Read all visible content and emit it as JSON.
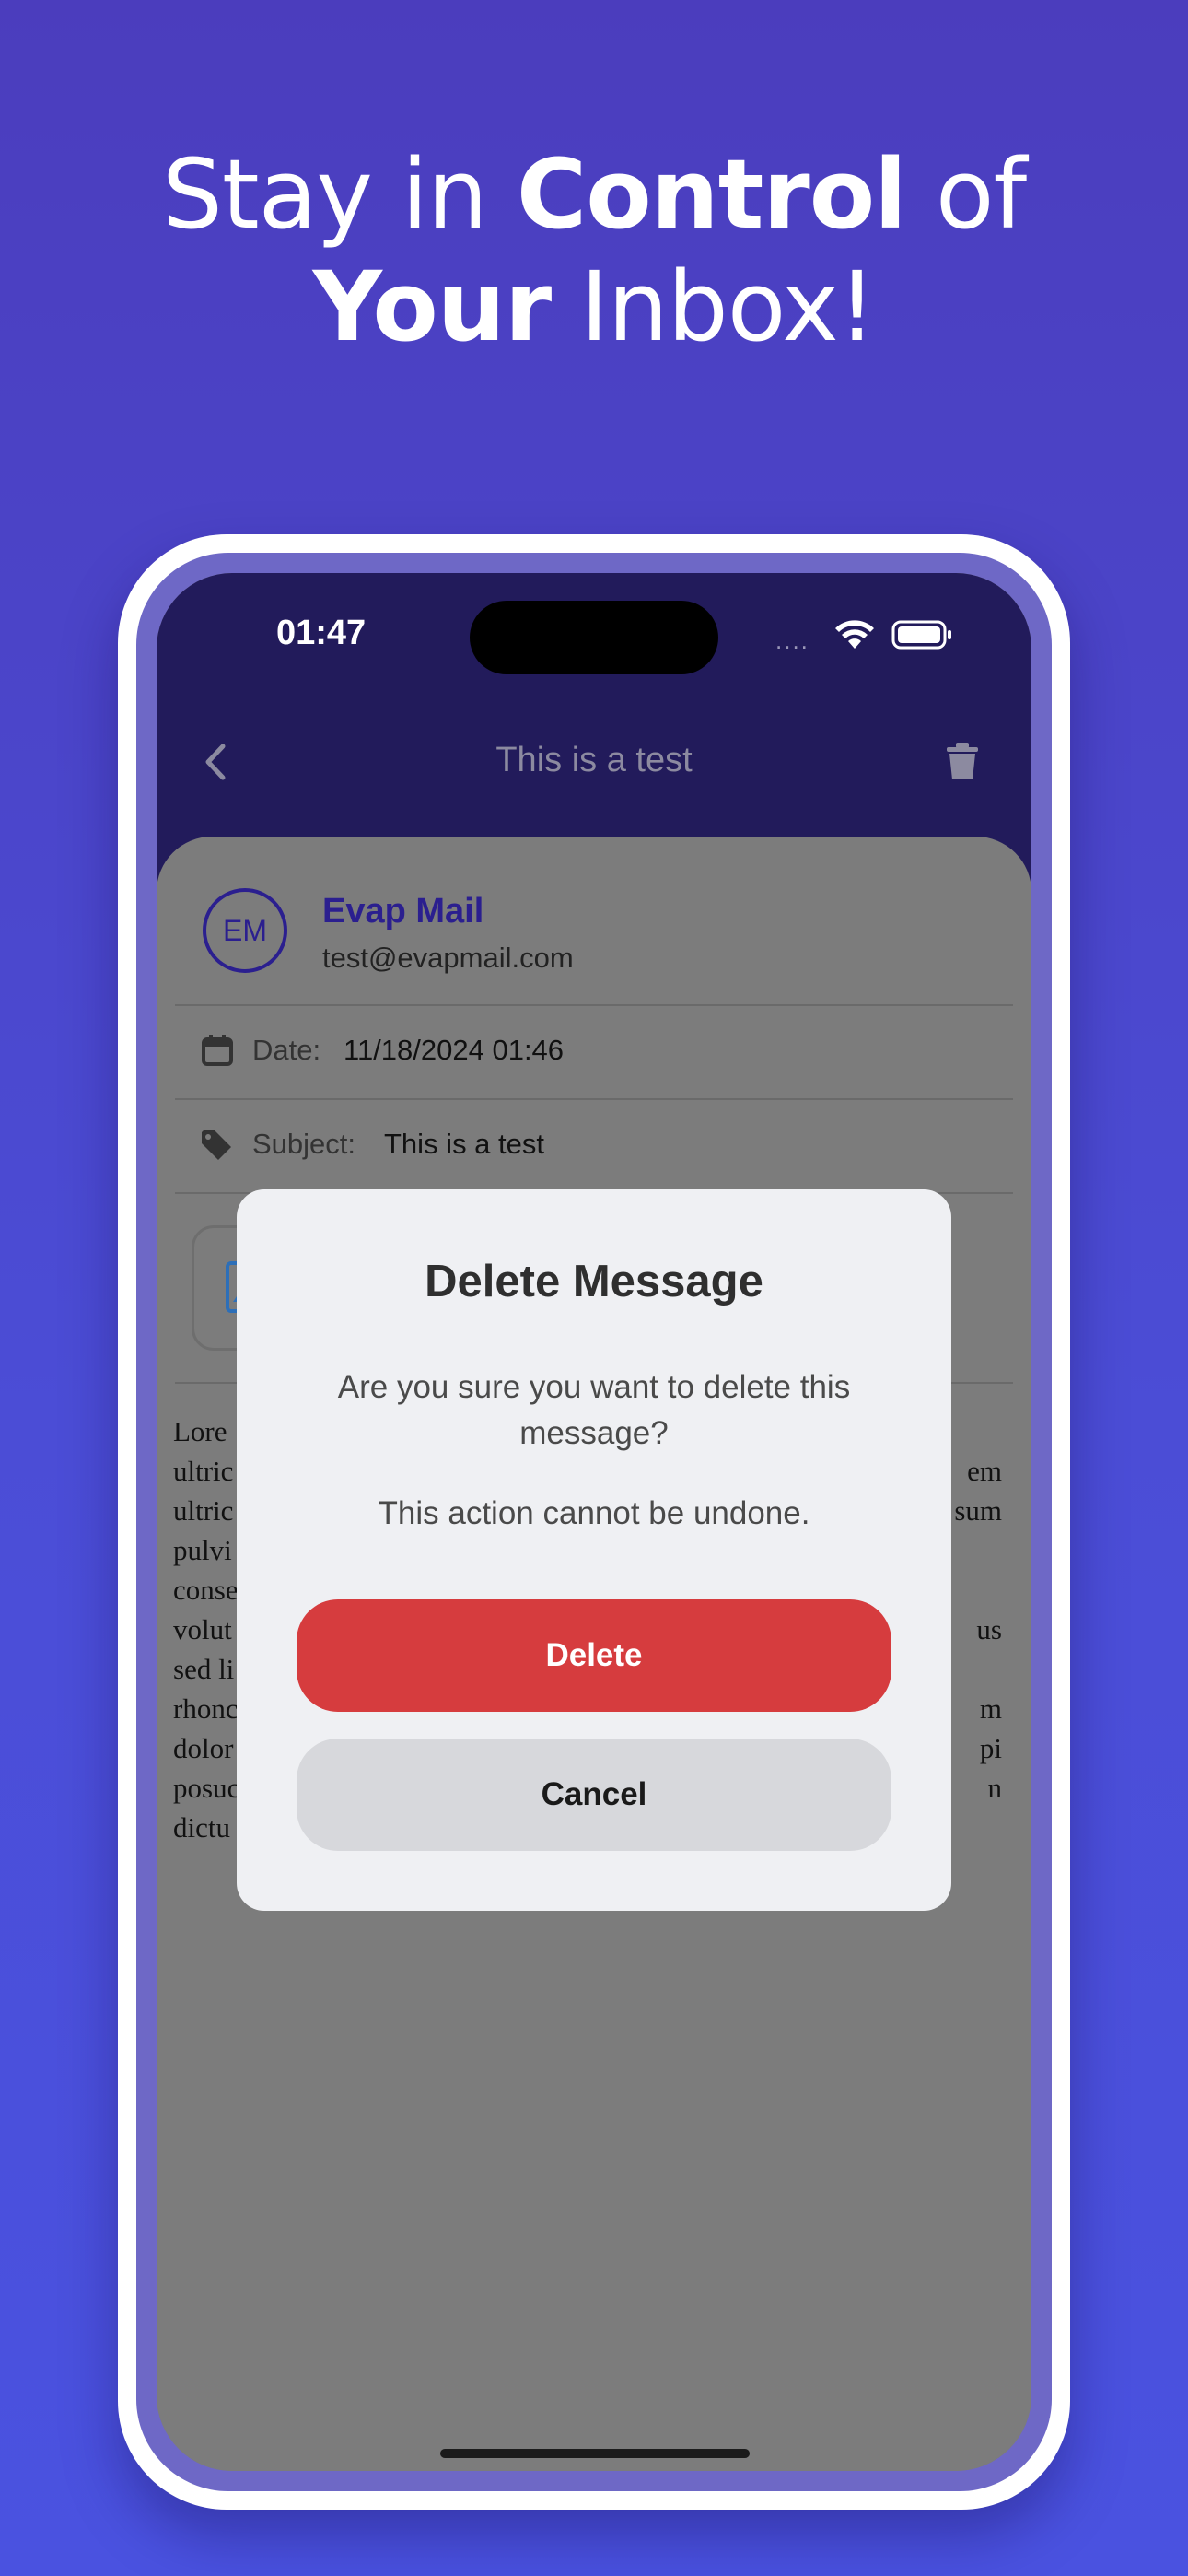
{
  "promo": {
    "line1_a": "Stay in ",
    "line1_b": "Control",
    "line1_c": " of",
    "line2_a": "Your",
    "line2_b": " Inbox!"
  },
  "status_bar": {
    "time": "01:47",
    "signal": "....",
    "wifi_icon": "wifi-icon",
    "battery_icon": "battery-icon"
  },
  "header": {
    "back_icon": "chevron-left-icon",
    "title": "This is a test",
    "trash_icon": "trash-icon"
  },
  "email": {
    "avatar_initials": "EM",
    "sender_name": "Evap Mail",
    "sender_email": "test@evapmail.com",
    "date_label": "Date:",
    "date_value": "11/18/2024 01:46",
    "subject_label": "Subject:",
    "subject_value": "This is a test",
    "body_lines": [
      "Lore",
      "ultric",
      "ultric",
      "pulvi",
      "conse",
      "volut",
      "sed li",
      "rhonc",
      "dolor",
      "posuc",
      "dictu"
    ],
    "body_lines_right": [
      "",
      "em",
      "sum",
      "",
      "",
      "us",
      "",
      "m",
      "pi",
      "n",
      ""
    ]
  },
  "dialog": {
    "title": "Delete Message",
    "question": "Are you sure you want to delete this message?",
    "warning": "This action cannot be undone.",
    "delete_label": "Delete",
    "cancel_label": "Cancel"
  },
  "colors": {
    "background": "#4b4dd6",
    "app_header": "#221b5b",
    "accent": "#2b1f8f",
    "delete": "#d63c3e",
    "cancel": "#d7d8dc",
    "dialog": "#eff0f3"
  }
}
